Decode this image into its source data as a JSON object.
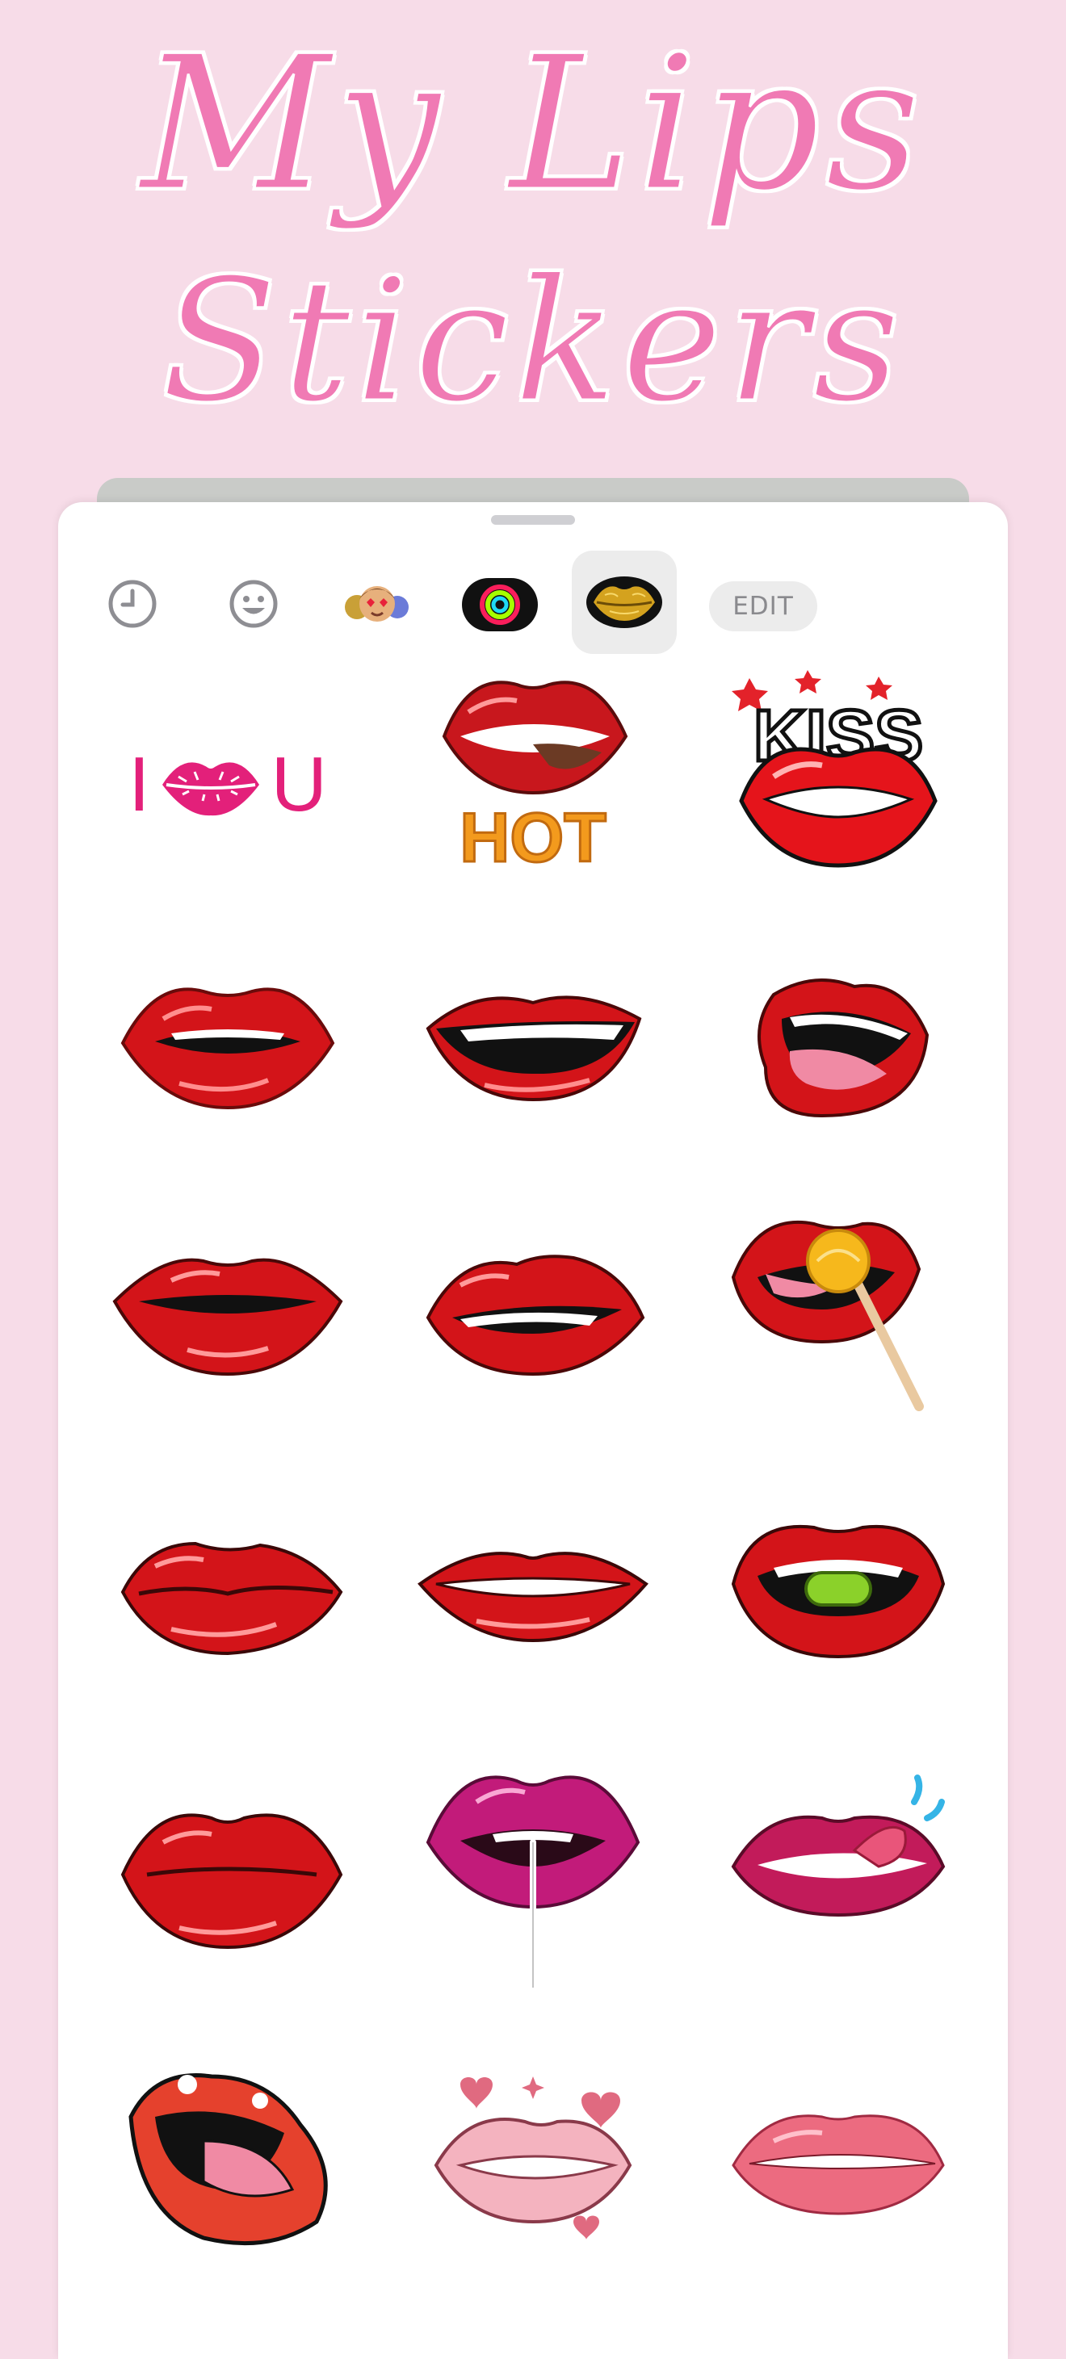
{
  "header": {
    "title_line1": "My Lips",
    "title_line2": "Stickers"
  },
  "drawer": {
    "tabs": [
      {
        "icon": "clock-icon"
      },
      {
        "icon": "smiley-icon"
      },
      {
        "icon": "memoji-icon"
      },
      {
        "icon": "activity-rings-icon"
      },
      {
        "icon": "gold-lips-icon",
        "selected": true
      }
    ],
    "edit_label": "EDIT"
  },
  "stickers": {
    "s1": {
      "left": "I",
      "right": "U"
    },
    "s2": {
      "text": "HOT"
    },
    "s3": {
      "text": "KISS"
    }
  },
  "colors": {
    "background": "#f7dce8",
    "title": "#f07ab4",
    "lip_red": "#d9161b",
    "lip_pink": "#c21b7a",
    "gold": "#d4a21e"
  }
}
